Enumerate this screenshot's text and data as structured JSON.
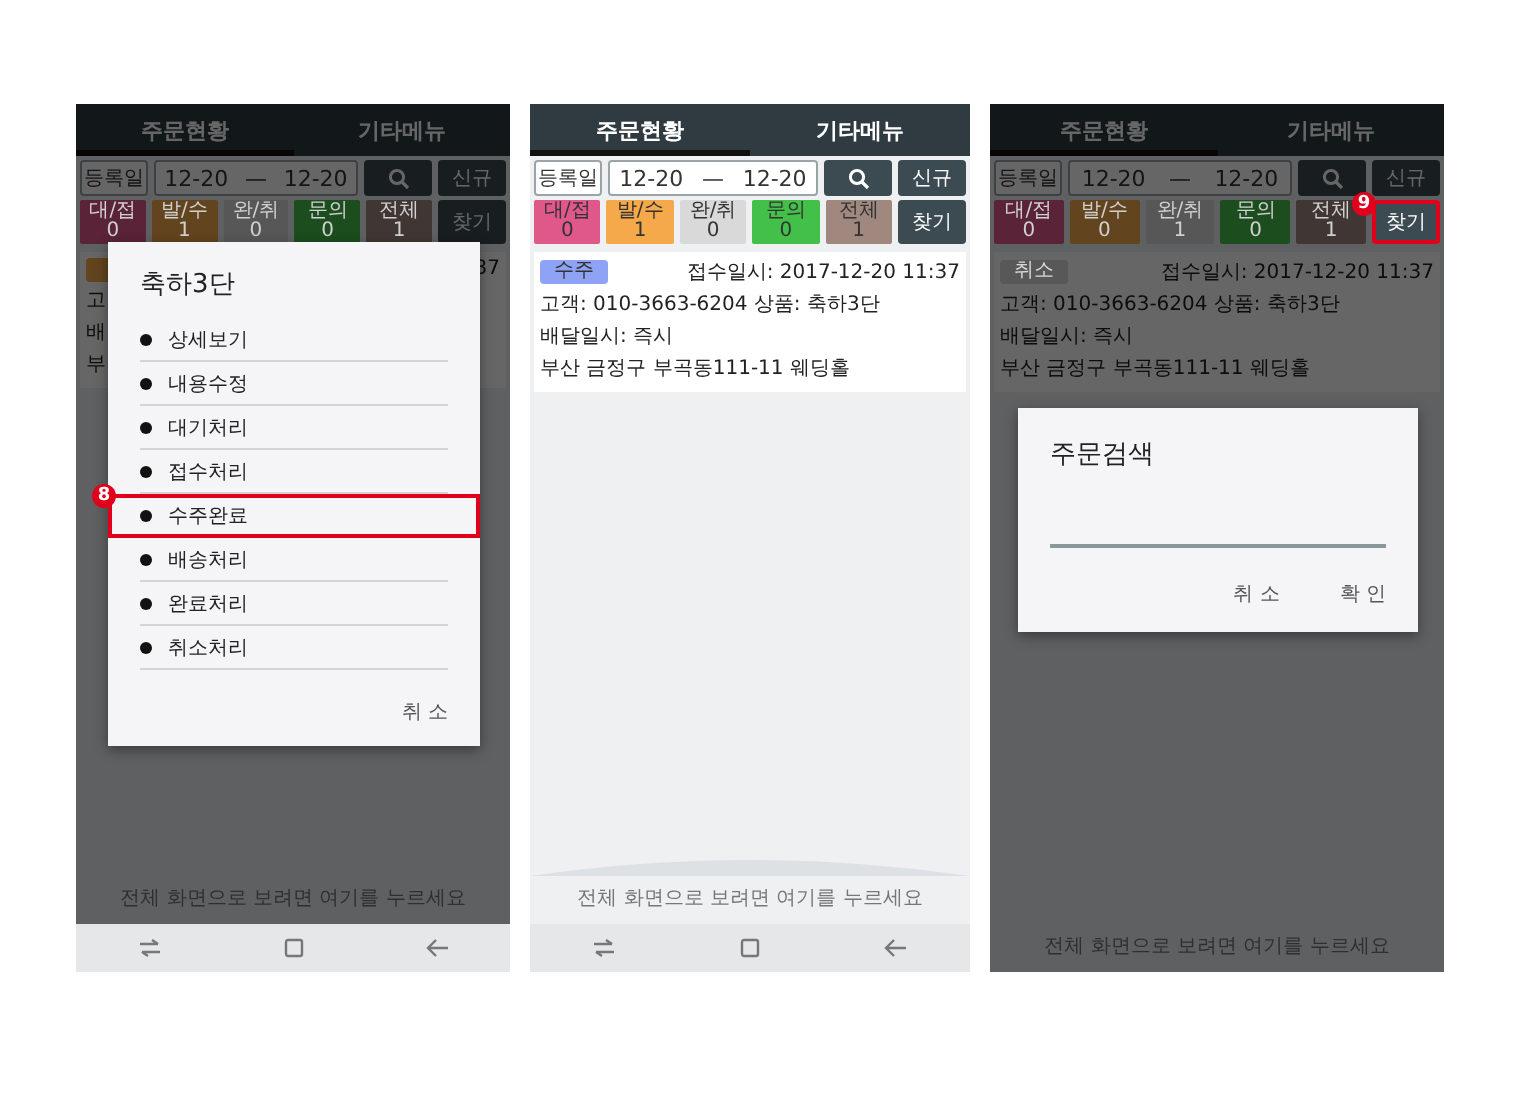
{
  "screens": [
    {
      "tabs": [
        {
          "label": "주문현황",
          "selected": true
        },
        {
          "label": "기타메뉴",
          "selected": false
        }
      ],
      "toolbar": {
        "date_button": "등록일",
        "date_from": "12-20",
        "date_separator": "—",
        "date_to": "12-20",
        "new_button": "신규",
        "find_button": "찾기",
        "find_highlighted": false
      },
      "status_tiles": [
        {
          "label": "대/접",
          "count": "0",
          "color": "#5a2337"
        },
        {
          "label": "발/수",
          "count": "1",
          "color": "#62441e"
        },
        {
          "label": "완/취",
          "count": "0",
          "color": "#575757"
        },
        {
          "label": "문의",
          "count": "0",
          "color": "#1b4d1e"
        },
        {
          "label": "전체",
          "count": "1",
          "color": "#403633"
        }
      ],
      "order": {
        "badge": {
          "color": "#62441e"
        },
        "received": "37",
        "lines": [
          "고",
          "배",
          "부"
        ]
      },
      "overscroll_glow": false,
      "hint": "전체 화면으로 보려면 여기를 누르세요",
      "dimmed": true,
      "nav_bar": true,
      "dialog": {
        "kind": "menu",
        "title": "축하3단",
        "items": [
          {
            "label": "상세보기",
            "highlighted": false
          },
          {
            "label": "내용수정",
            "highlighted": false
          },
          {
            "label": "대기처리",
            "highlighted": false
          },
          {
            "label": "접수처리",
            "highlighted": false
          },
          {
            "label": "수주완료",
            "highlighted": true,
            "callout": "8"
          },
          {
            "label": "배송처리",
            "highlighted": false
          },
          {
            "label": "완료처리",
            "highlighted": false
          },
          {
            "label": "취소처리",
            "highlighted": false
          }
        ],
        "buttons": [
          "취 소"
        ]
      }
    },
    {
      "tabs": [
        {
          "label": "주문현황",
          "selected": true
        },
        {
          "label": "기타메뉴",
          "selected": false
        }
      ],
      "toolbar": {
        "date_button": "등록일",
        "date_from": "12-20",
        "date_separator": "—",
        "date_to": "12-20",
        "new_button": "신규",
        "find_button": "찾기",
        "find_highlighted": false
      },
      "status_tiles": [
        {
          "label": "대/접",
          "count": "0",
          "color": "#e0588a"
        },
        {
          "label": "발/수",
          "count": "1",
          "color": "#f5a94a"
        },
        {
          "label": "완/취",
          "count": "0",
          "color": "#d9d9d9"
        },
        {
          "label": "문의",
          "count": "0",
          "color": "#43c04a"
        },
        {
          "label": "전체",
          "count": "1",
          "color": "#a1887f"
        }
      ],
      "order": {
        "badge": {
          "text": "수주",
          "color": "#8ea3f5"
        },
        "received": "접수일시: 2017-12-20 11:37",
        "lines": [
          "고객: 010-3663-6204 상품: 축하3단",
          "배달일시: 즉시",
          "부산 금정구 부곡동111-11 웨딩홀"
        ]
      },
      "overscroll_glow": true,
      "hint": "전체 화면으로 보려면 여기를 누르세요",
      "dimmed": false,
      "nav_bar": true
    },
    {
      "tabs": [
        {
          "label": "주문현황",
          "selected": true
        },
        {
          "label": "기타메뉴",
          "selected": false
        }
      ],
      "toolbar": {
        "date_button": "등록일",
        "date_from": "12-20",
        "date_separator": "—",
        "date_to": "12-20",
        "new_button": "신규",
        "find_button": "찾기",
        "find_highlighted": true,
        "callout": "9"
      },
      "status_tiles": [
        {
          "label": "대/접",
          "count": "0",
          "color": "#5a2337"
        },
        {
          "label": "발/수",
          "count": "0",
          "color": "#62441e"
        },
        {
          "label": "완/취",
          "count": "1",
          "color": "#575757"
        },
        {
          "label": "문의",
          "count": "0",
          "color": "#1b4d1e"
        },
        {
          "label": "전체",
          "count": "1",
          "color": "#403633"
        }
      ],
      "order": {
        "badge": {
          "text": "취소",
          "color": "#585858"
        },
        "received": "접수일시: 2017-12-20 11:37",
        "lines": [
          "고객: 010-3663-6204 상품: 축하3단",
          "배달일시: 즉시",
          "부산 금정구 부곡동111-11 웨딩홀"
        ]
      },
      "overscroll_glow": false,
      "hint": "전체 화면으로 보려면 여기를 누르세요",
      "dimmed": true,
      "nav_bar": false,
      "dialog": {
        "kind": "prompt",
        "title": "주문검색",
        "buttons": [
          "취 소",
          "확 인"
        ]
      }
    }
  ]
}
